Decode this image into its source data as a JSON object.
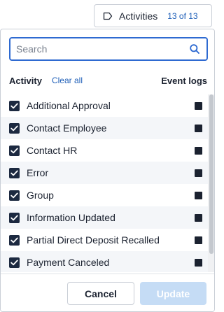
{
  "trigger": {
    "icon": "tag-icon",
    "label": "Activities",
    "count": "13 of 13"
  },
  "search": {
    "placeholder": "Search",
    "value": "",
    "icon": "search-icon"
  },
  "header": {
    "activity_label": "Activity",
    "clear_all_label": "Clear all",
    "event_logs_label": "Event logs"
  },
  "activities": [
    {
      "label": "Additional Approval",
      "checked": true
    },
    {
      "label": "Contact Employee",
      "checked": true
    },
    {
      "label": "Contact HR",
      "checked": true
    },
    {
      "label": "Error",
      "checked": true
    },
    {
      "label": "Group",
      "checked": true
    },
    {
      "label": "Information Updated",
      "checked": true
    },
    {
      "label": "Partial Direct Deposit Recalled",
      "checked": true
    },
    {
      "label": "Payment Canceled",
      "checked": true
    }
  ],
  "footer": {
    "cancel_label": "Cancel",
    "update_label": "Update"
  },
  "colors": {
    "accent": "#1f5fb8",
    "focus_border": "#2e6ad1",
    "checkbox": "#1c2940",
    "update_disabled_bg": "#c5dcf5"
  }
}
